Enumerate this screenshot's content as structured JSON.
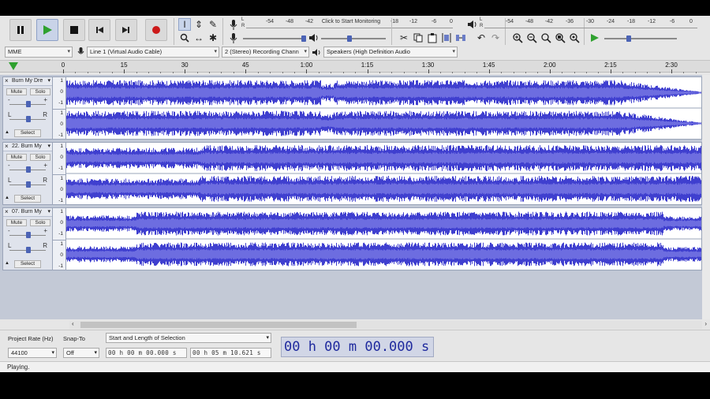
{
  "colors": {
    "wave": "#3f3fcf",
    "wave_bg": "#ffffff",
    "play_green": "#2fa12f",
    "record_red": "#cc1a1a",
    "time_text": "#1f2a9e"
  },
  "meters": {
    "record": {
      "left_label": "L",
      "right_label": "R",
      "ticks": [
        "-54",
        "-48",
        "-42",
        "Click to Start Monitoring",
        "-18",
        "-12",
        "-6",
        "0"
      ]
    },
    "playback": {
      "left_label": "L",
      "right_label": "R",
      "ticks": [
        "-54",
        "-48",
        "-42",
        "-36",
        "-30",
        "-24",
        "-18",
        "-12",
        "-6",
        "0"
      ]
    }
  },
  "device_toolbar": {
    "host": "MME",
    "recording_device": "Line 1 (Virtual Audio Cable)",
    "channels": "2 (Stereo) Recording Chann",
    "playback_device": "Speakers (High Definition Audio"
  },
  "timeline": {
    "labels": [
      "0",
      "15",
      "30",
      "45",
      "1:00",
      "1:15",
      "1:30",
      "1:45",
      "2:00",
      "2:15",
      "2:30"
    ]
  },
  "tracks": [
    {
      "name": "Burn My Dre",
      "mute": "Mute",
      "solo": "Solo",
      "gain_minus": "-",
      "gain_plus": "+",
      "pan_left": "L",
      "pan_right": "R",
      "select": "Select",
      "scale": [
        "1",
        "0",
        "-1",
        "1",
        "0",
        "-1"
      ]
    },
    {
      "name": "22. Burn My",
      "mute": "Mute",
      "solo": "Solo",
      "gain_minus": "-",
      "gain_plus": "+",
      "pan_left": "L",
      "pan_right": "R",
      "select": "Select",
      "scale": [
        "1",
        "0",
        "-1",
        "1",
        "0",
        "-1"
      ]
    },
    {
      "name": "07. Burn My",
      "mute": "Mute",
      "solo": "Solo",
      "gain_minus": "-",
      "gain_plus": "+",
      "pan_left": "L",
      "pan_right": "R",
      "select": "Select",
      "scale": [
        "1",
        "0",
        "-1",
        "1",
        "0",
        "-1"
      ]
    }
  ],
  "selection_toolbar": {
    "project_rate_label": "Project Rate (Hz)",
    "project_rate_value": "44100",
    "snap_to_label": "Snap-To",
    "snap_to_value": "Off",
    "selection_mode": "Start and Length of Selection",
    "start_time": "00 h 00 m 00.000 s",
    "length_time": "00 h 05 m 10.621 s",
    "audio_position": "00 h 00 m 00.000 s"
  },
  "status": "Playing."
}
